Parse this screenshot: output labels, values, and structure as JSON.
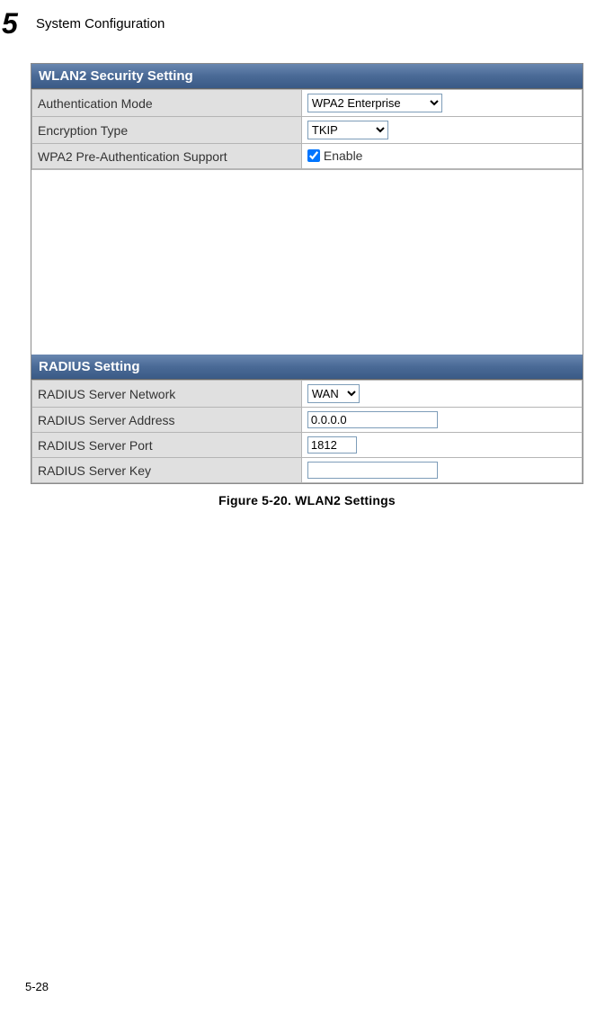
{
  "header": {
    "chapter": "5",
    "title": "System Configuration"
  },
  "panel": {
    "section1_title": "WLAN2 Security Setting",
    "auth_mode_label": "Authentication Mode",
    "auth_mode_value": "WPA2 Enterprise",
    "encryption_label": "Encryption Type",
    "encryption_value": "TKIP",
    "preauth_label": "WPA2 Pre-Authentication Support",
    "preauth_checkbox_label": "Enable",
    "section2_title": "RADIUS Setting",
    "radius_network_label": "RADIUS Server Network",
    "radius_network_value": "WAN",
    "radius_address_label": "RADIUS Server Address",
    "radius_address_value": "0.0.0.0",
    "radius_port_label": "RADIUS Server Port",
    "radius_port_value": "1812",
    "radius_key_label": "RADIUS Server Key",
    "radius_key_value": ""
  },
  "figure_caption": "Figure 5-20.   WLAN2 Settings",
  "page_number": "5-28"
}
